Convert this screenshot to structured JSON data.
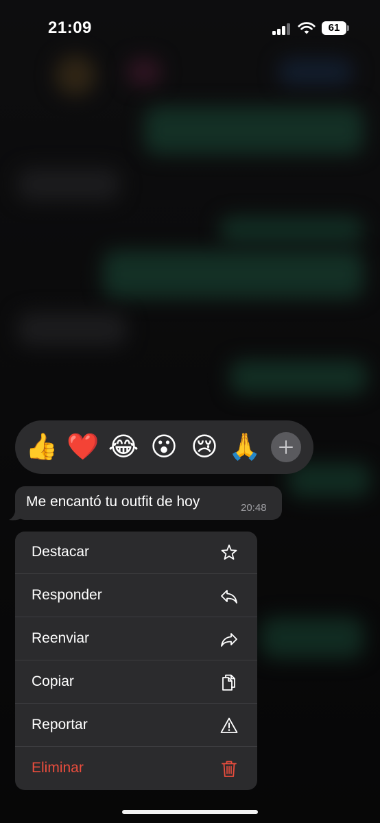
{
  "status_bar": {
    "time": "21:09",
    "battery_level": "61"
  },
  "reactions": {
    "items": [
      "👍",
      "❤️",
      "😂",
      "😮",
      "😢",
      "🙏"
    ],
    "more_icon": "plus-icon"
  },
  "message": {
    "text": "Me encantó tu outfit de hoy",
    "time": "20:48"
  },
  "menu": {
    "items": [
      {
        "label": "Destacar",
        "icon": "star-icon"
      },
      {
        "label": "Responder",
        "icon": "reply-icon"
      },
      {
        "label": "Reenviar",
        "icon": "forward-icon"
      },
      {
        "label": "Copiar",
        "icon": "copy-icon"
      },
      {
        "label": "Reportar",
        "icon": "warning-icon"
      },
      {
        "label": "Eliminar",
        "icon": "trash-icon",
        "destructive": true
      }
    ]
  },
  "colors": {
    "menu_background": "#2b2b2d",
    "bubble_background": "#2c2c2e",
    "destructive": "#eb4d3d"
  }
}
